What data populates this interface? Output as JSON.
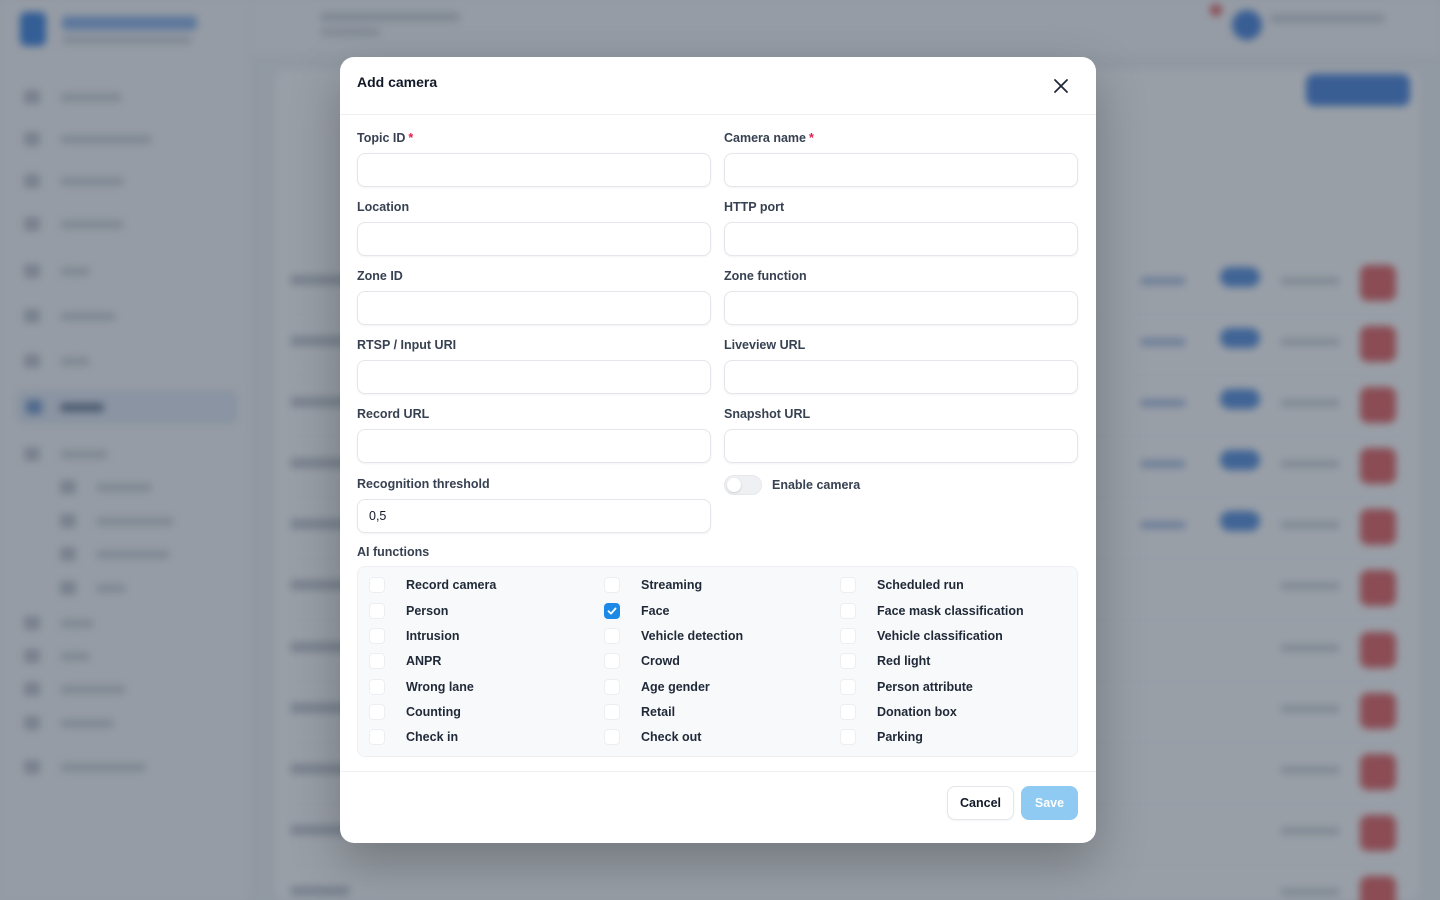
{
  "modal": {
    "title": "Add camera",
    "close_icon": "close-icon",
    "required_marker": "*",
    "fields": {
      "topic_id": {
        "label": "Topic ID",
        "value": "",
        "required": true
      },
      "camera_name": {
        "label": "Camera name",
        "value": "",
        "required": true
      },
      "location": {
        "label": "Location",
        "value": ""
      },
      "http_port": {
        "label": "HTTP port",
        "value": ""
      },
      "zone_id": {
        "label": "Zone ID",
        "value": ""
      },
      "zone_function": {
        "label": "Zone function",
        "value": ""
      },
      "rtsp_uri": {
        "label": "RTSP / Input URI",
        "value": ""
      },
      "liveview_url": {
        "label": "Liveview URL",
        "value": ""
      },
      "record_url": {
        "label": "Record URL",
        "value": ""
      },
      "snapshot_url": {
        "label": "Snapshot URL",
        "value": ""
      },
      "recognition_threshold": {
        "label": "Recognition threshold",
        "value": "0,5"
      }
    },
    "enable_camera": {
      "label": "Enable camera",
      "on": false
    },
    "ai_functions": {
      "label": "AI functions",
      "items": [
        {
          "label": "Record camera",
          "checked": false
        },
        {
          "label": "Streaming",
          "checked": false
        },
        {
          "label": "Scheduled run",
          "checked": false
        },
        {
          "label": "Person",
          "checked": false
        },
        {
          "label": "Face",
          "checked": true
        },
        {
          "label": "Face mask classification",
          "checked": false
        },
        {
          "label": "Intrusion",
          "checked": false
        },
        {
          "label": "Vehicle detection",
          "checked": false
        },
        {
          "label": "Vehicle classification",
          "checked": false
        },
        {
          "label": "ANPR",
          "checked": false
        },
        {
          "label": "Crowd",
          "checked": false
        },
        {
          "label": "Red light",
          "checked": false
        },
        {
          "label": "Wrong lane",
          "checked": false
        },
        {
          "label": "Age gender",
          "checked": false
        },
        {
          "label": "Person attribute",
          "checked": false
        },
        {
          "label": "Counting",
          "checked": false
        },
        {
          "label": "Retail",
          "checked": false
        },
        {
          "label": "Donation box",
          "checked": false
        },
        {
          "label": "Check in",
          "checked": false
        },
        {
          "label": "Check out",
          "checked": false
        },
        {
          "label": "Parking",
          "checked": false
        }
      ]
    },
    "footer": {
      "cancel_label": "Cancel",
      "save_label": "Save"
    }
  },
  "colors": {
    "primary": "#1a8ae6",
    "save_disabled": "#8fcaf2",
    "required": "#e11d48"
  }
}
